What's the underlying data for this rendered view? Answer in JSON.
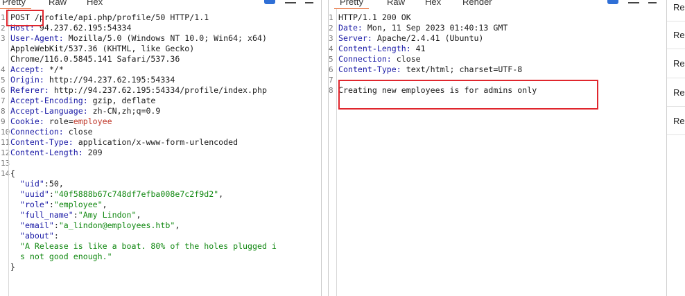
{
  "request": {
    "tabs": [
      "Pretty",
      "Raw",
      "Hex"
    ],
    "lines": [
      {
        "n": "1",
        "parts": [
          [
            "method",
            "POST"
          ],
          [
            "plain",
            " /profile/api.php/profile/50 HTTP/1.1"
          ]
        ]
      },
      {
        "n": "2",
        "parts": [
          [
            "hname",
            "Host:"
          ],
          [
            "hval",
            " 94.237.62.195:54334"
          ]
        ]
      },
      {
        "n": "3",
        "parts": [
          [
            "hname",
            "User-Agent:"
          ],
          [
            "hval",
            " Mozilla/5.0 (Windows NT 10.0; Win64; x64)"
          ]
        ]
      },
      {
        "n": "",
        "parts": [
          [
            "hval",
            "AppleWebKit/537.36 (KHTML, like Gecko)"
          ]
        ]
      },
      {
        "n": "",
        "parts": [
          [
            "hval",
            "Chrome/116.0.5845.141 Safari/537.36"
          ]
        ]
      },
      {
        "n": "4",
        "parts": [
          [
            "hname",
            "Accept:"
          ],
          [
            "hval",
            " */*"
          ]
        ]
      },
      {
        "n": "5",
        "parts": [
          [
            "hname",
            "Origin:"
          ],
          [
            "hval",
            " http://94.237.62.195:54334"
          ]
        ]
      },
      {
        "n": "6",
        "parts": [
          [
            "hname",
            "Referer:"
          ],
          [
            "hval",
            " http://94.237.62.195:54334/profile/index.php"
          ]
        ]
      },
      {
        "n": "7",
        "parts": [
          [
            "hname",
            "Accept-Encoding:"
          ],
          [
            "hval",
            " gzip, deflate"
          ]
        ]
      },
      {
        "n": "8",
        "parts": [
          [
            "hname",
            "Accept-Language:"
          ],
          [
            "hval",
            " zh-CN,zh;q=0.9"
          ]
        ]
      },
      {
        "n": "9",
        "parts": [
          [
            "hname",
            "Cookie:"
          ],
          [
            "hval",
            " role="
          ],
          [
            "cookie",
            "employee"
          ]
        ]
      },
      {
        "n": "10",
        "parts": [
          [
            "hname",
            "Connection:"
          ],
          [
            "hval",
            " close"
          ]
        ]
      },
      {
        "n": "11",
        "parts": [
          [
            "hname",
            "Content-Type:"
          ],
          [
            "hval",
            " application/x-www-form-urlencoded"
          ]
        ]
      },
      {
        "n": "12",
        "parts": [
          [
            "hname",
            "Content-Length:"
          ],
          [
            "hval",
            " 209"
          ]
        ]
      },
      {
        "n": "13",
        "parts": []
      },
      {
        "n": "14",
        "parts": [
          [
            "plain",
            "{"
          ]
        ]
      },
      {
        "n": "",
        "parts": [
          [
            "plain",
            "  "
          ],
          [
            "jkey",
            "\"uid\""
          ],
          [
            "plain",
            ":"
          ],
          [
            "jnum",
            "50"
          ],
          [
            "plain",
            ","
          ]
        ]
      },
      {
        "n": "",
        "parts": [
          [
            "plain",
            "  "
          ],
          [
            "jkey",
            "\"uuid\""
          ],
          [
            "plain",
            ":"
          ],
          [
            "jstr",
            "\"40f5888b67c748df7efba008e7c2f9d2\""
          ],
          [
            "plain",
            ","
          ]
        ]
      },
      {
        "n": "",
        "parts": [
          [
            "plain",
            "  "
          ],
          [
            "jkey",
            "\"role\""
          ],
          [
            "plain",
            ":"
          ],
          [
            "jstr",
            "\"employee\""
          ],
          [
            "plain",
            ","
          ]
        ]
      },
      {
        "n": "",
        "parts": [
          [
            "plain",
            "  "
          ],
          [
            "jkey",
            "\"full_name\""
          ],
          [
            "plain",
            ":"
          ],
          [
            "jstr",
            "\"Amy Lindon\""
          ],
          [
            "plain",
            ","
          ]
        ]
      },
      {
        "n": "",
        "parts": [
          [
            "plain",
            "  "
          ],
          [
            "jkey",
            "\"email\""
          ],
          [
            "plain",
            ":"
          ],
          [
            "jstr",
            "\"a_lindon@employees.htb\""
          ],
          [
            "plain",
            ","
          ]
        ]
      },
      {
        "n": "",
        "parts": [
          [
            "plain",
            "  "
          ],
          [
            "jkey",
            "\"about\""
          ],
          [
            "plain",
            ":"
          ]
        ]
      },
      {
        "n": "",
        "parts": [
          [
            "plain",
            "  "
          ],
          [
            "jstr",
            "\"A Release is like a boat. 80% of the holes plugged i"
          ]
        ]
      },
      {
        "n": "",
        "parts": [
          [
            "plain",
            "  "
          ],
          [
            "jstr",
            "s not good enough.\""
          ]
        ]
      },
      {
        "n": "",
        "parts": [
          [
            "plain",
            "}"
          ]
        ]
      }
    ]
  },
  "response": {
    "tabs": [
      "Pretty",
      "Raw",
      "Hex",
      "Render"
    ],
    "lines": [
      {
        "n": "1",
        "parts": [
          [
            "plain",
            "HTTP/1.1 200 OK"
          ]
        ]
      },
      {
        "n": "2",
        "parts": [
          [
            "hname",
            "Date:"
          ],
          [
            "hval",
            " Mon, 11 Sep 2023 01:40:13 GMT"
          ]
        ]
      },
      {
        "n": "3",
        "parts": [
          [
            "hname",
            "Server:"
          ],
          [
            "hval",
            " Apache/2.4.41 (Ubuntu)"
          ]
        ]
      },
      {
        "n": "4",
        "parts": [
          [
            "hname",
            "Content-Length:"
          ],
          [
            "hval",
            " 41"
          ]
        ]
      },
      {
        "n": "5",
        "parts": [
          [
            "hname",
            "Connection:"
          ],
          [
            "hval",
            " close"
          ]
        ]
      },
      {
        "n": "6",
        "parts": [
          [
            "hname",
            "Content-Type:"
          ],
          [
            "hval",
            " text/html; charset=UTF-8"
          ]
        ]
      },
      {
        "n": "7",
        "parts": []
      },
      {
        "n": "8",
        "parts": [
          [
            "plain",
            "Creating new employees is for admins only"
          ]
        ]
      }
    ]
  },
  "side_panel": {
    "items": [
      "Re",
      "Re",
      "Re",
      "Re",
      "Re"
    ]
  },
  "colors": {
    "accent": "#e8703a",
    "highlight_box": "#e0262d",
    "header_name": "#1a1aa6",
    "json_string": "#118811",
    "cookie_value": "#c0392b"
  }
}
